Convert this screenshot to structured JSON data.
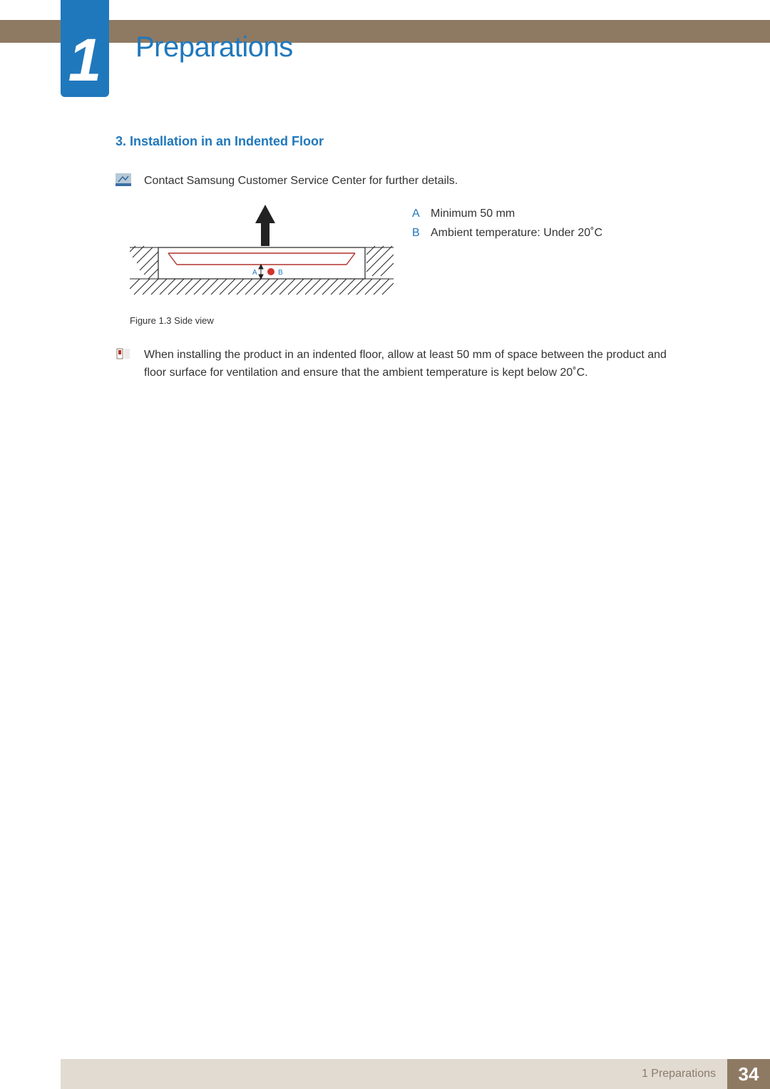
{
  "chapter": {
    "number": "1",
    "title": "Preparations"
  },
  "section": {
    "heading": "3. Installation in an Indented Floor",
    "note": "Contact Samsung Customer Service Center for further details.",
    "figure_caption": "Figure 1.3  Side view",
    "figure_label_a": "A",
    "figure_label_b": "B",
    "legend": [
      {
        "letter": "A",
        "text": "Minimum 50 mm"
      },
      {
        "letter": "B",
        "text": "Ambient temperature: Under 20˚C"
      }
    ],
    "warning": "When installing the product in an indented floor, allow at least 50 mm of space between the product and floor surface for ventilation and ensure that the ambient temperature is kept below 20˚C."
  },
  "footer": {
    "section_label": "1 Preparations",
    "page_number": "34"
  }
}
